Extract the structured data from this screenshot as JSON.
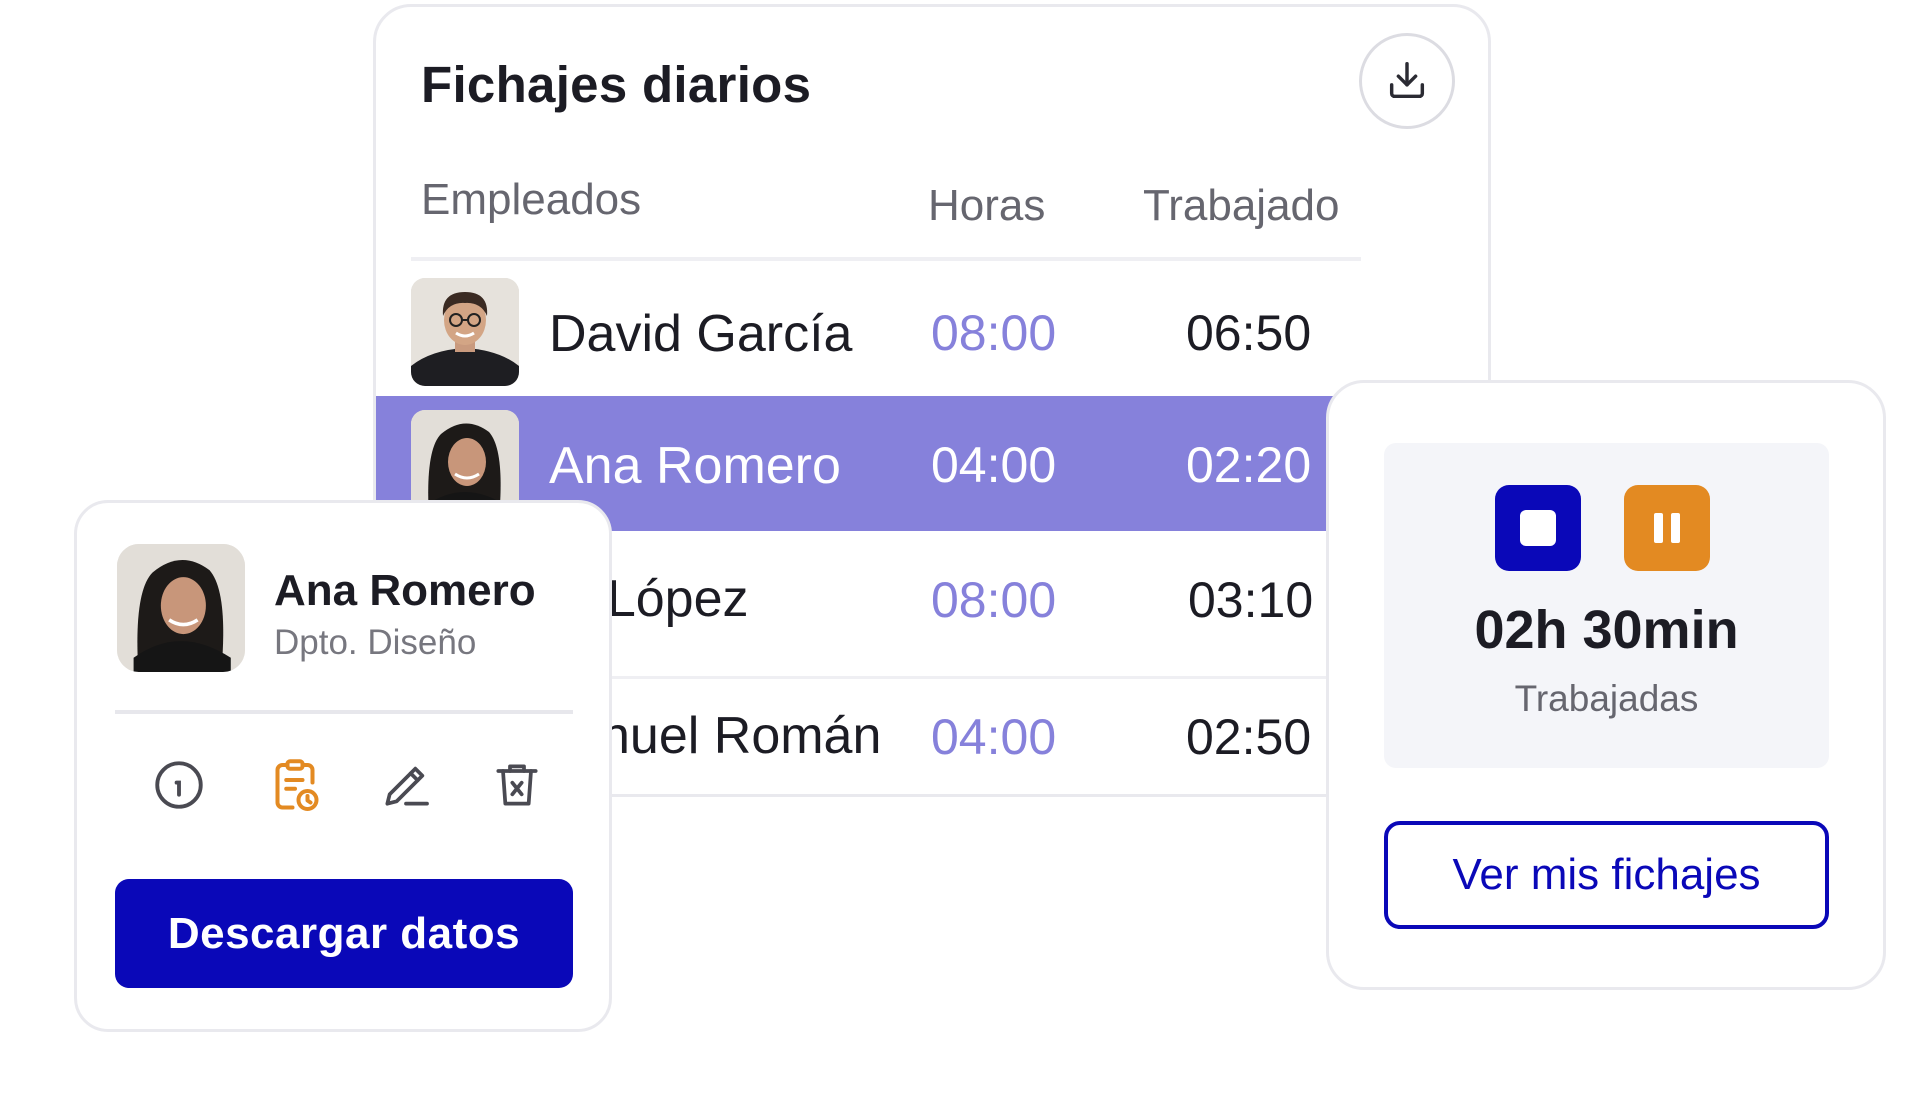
{
  "daily_records": {
    "title": "Fichajes diarios",
    "download_icon": "download-icon",
    "columns": {
      "employees": "Empleados",
      "hours": "Horas",
      "worked": "Trabajado"
    },
    "rows": [
      {
        "name": "David García",
        "hours": "08:00",
        "worked": "06:50",
        "selected": false
      },
      {
        "name": "Ana Romero",
        "hours": "04:00",
        "worked": "02:20",
        "selected": true
      },
      {
        "name": "ía López",
        "hours": "08:00",
        "worked": "03:10",
        "selected": false
      },
      {
        "name": "nuel Román",
        "hours": "04:00",
        "worked": "02:50",
        "selected": false
      }
    ]
  },
  "profile": {
    "name": "Ana Romero",
    "department": "Dpto. Diseño",
    "actions": [
      "info-icon",
      "clipboard-clock-icon",
      "edit-icon",
      "delete-icon"
    ],
    "download_button": "Descargar datos"
  },
  "timer": {
    "elapsed": "02h 30min",
    "elapsed_label": "Trabajadas",
    "view_button": "Ver mis fichajes"
  },
  "colors": {
    "primary": "#0a08b8",
    "accent_purple": "#8681db",
    "accent_orange": "#e38a22"
  }
}
